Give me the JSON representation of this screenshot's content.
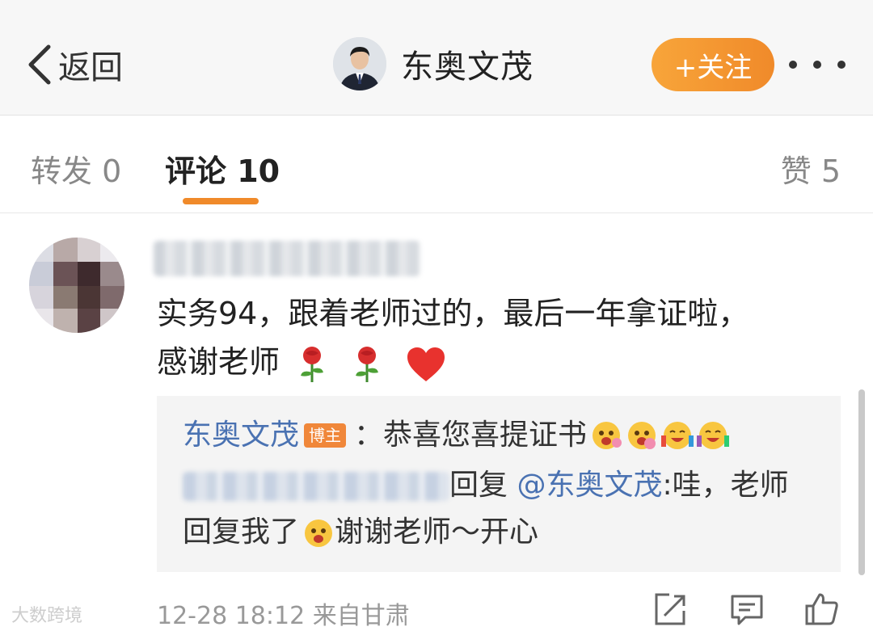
{
  "header": {
    "back_label": "返回",
    "profile_name": "东奥文茂",
    "follow_label": "+关注"
  },
  "tabs": {
    "repost": "转发 0",
    "comment": "评论 10",
    "like": "赞 5"
  },
  "comment": {
    "text_line1": "实务94，跟着老师过的，最后一年拿证啦，",
    "text_line2": "感谢老师",
    "meta": "12-28 18:12 来自甘肃"
  },
  "reply": {
    "author": "东奥文茂",
    "badge": "博主",
    "text": "：恭喜您喜提证书",
    "line2_reply_word": "回复",
    "line2_mention": "@东奥文茂",
    "line2_text_a": ":哇，老师",
    "line2_text_b": "回复我了",
    "line2_text_c": "谢谢老师～开心"
  },
  "watermark": "大数跨境",
  "colors": {
    "accent": "#f08a2a",
    "link": "#4a72b2",
    "badge": "#f0873a"
  },
  "icons": [
    "back-chevron-icon",
    "more-dots-icon",
    "rose-icon",
    "heart-icon",
    "happy-face-icon",
    "share-icon",
    "comment-icon",
    "thumbs-up-icon"
  ]
}
